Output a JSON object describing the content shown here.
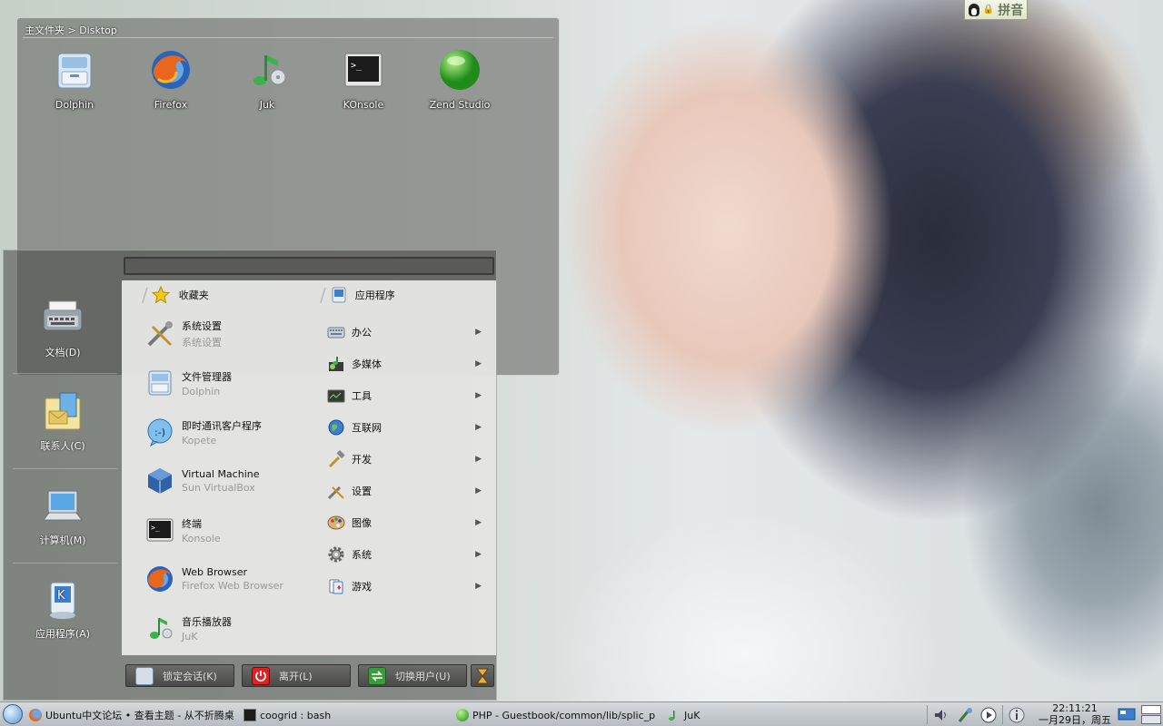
{
  "folder_view": {
    "path": "主文件夹 > Disktop",
    "icons": [
      {
        "name": "dolphin",
        "label": "Dolphin"
      },
      {
        "name": "firefox",
        "label": "Firefox"
      },
      {
        "name": "juk",
        "label": "Juk"
      },
      {
        "name": "konsole",
        "label": "KOnsole"
      },
      {
        "name": "zend",
        "label": "Zend Studio"
      }
    ]
  },
  "ime": {
    "label": "拼音"
  },
  "menu": {
    "left": [
      {
        "name": "documents",
        "label": "文档(D)"
      },
      {
        "name": "contacts",
        "label": "联系人(C)"
      },
      {
        "name": "computer",
        "label": "计算机(M)"
      },
      {
        "name": "applications",
        "label": "应用程序(A)"
      }
    ],
    "favorites_header": "收藏夹",
    "applications_header": "应用程序",
    "favorites": [
      {
        "title": "系统设置",
        "subtitle": "系统设置"
      },
      {
        "title": "文件管理器",
        "subtitle": "Dolphin"
      },
      {
        "title": "即时通讯客户程序",
        "subtitle": "Kopete"
      },
      {
        "title": "Virtual Machine",
        "subtitle": "Sun VirtualBox"
      },
      {
        "title": "终端",
        "subtitle": "Konsole"
      },
      {
        "title": "Web Browser",
        "subtitle": "Firefox Web Browser"
      },
      {
        "title": "音乐播放器",
        "subtitle": "JuK"
      }
    ],
    "categories": [
      "办公",
      "多媒体",
      "工具",
      "互联网",
      "开发",
      "设置",
      "图像",
      "系统",
      "游戏"
    ],
    "bottom": {
      "lock": "锁定会话(K)",
      "leave": "离开(L)",
      "switch": "切换用户(U)"
    }
  },
  "taskbar": {
    "tasks": [
      "Ubuntu中文论坛 • 查看主题 - 从不折腾桌",
      "coogrid : bash",
      "PHP - Guestbook/common/lib/splic_p",
      "JuK"
    ],
    "time": "22:11:21",
    "date": "一月29日，周五"
  },
  "colors": {
    "panel_bg": "#ebebe9",
    "menu_bg": "#464644",
    "taskbar_bg": "#c4c9cd"
  }
}
